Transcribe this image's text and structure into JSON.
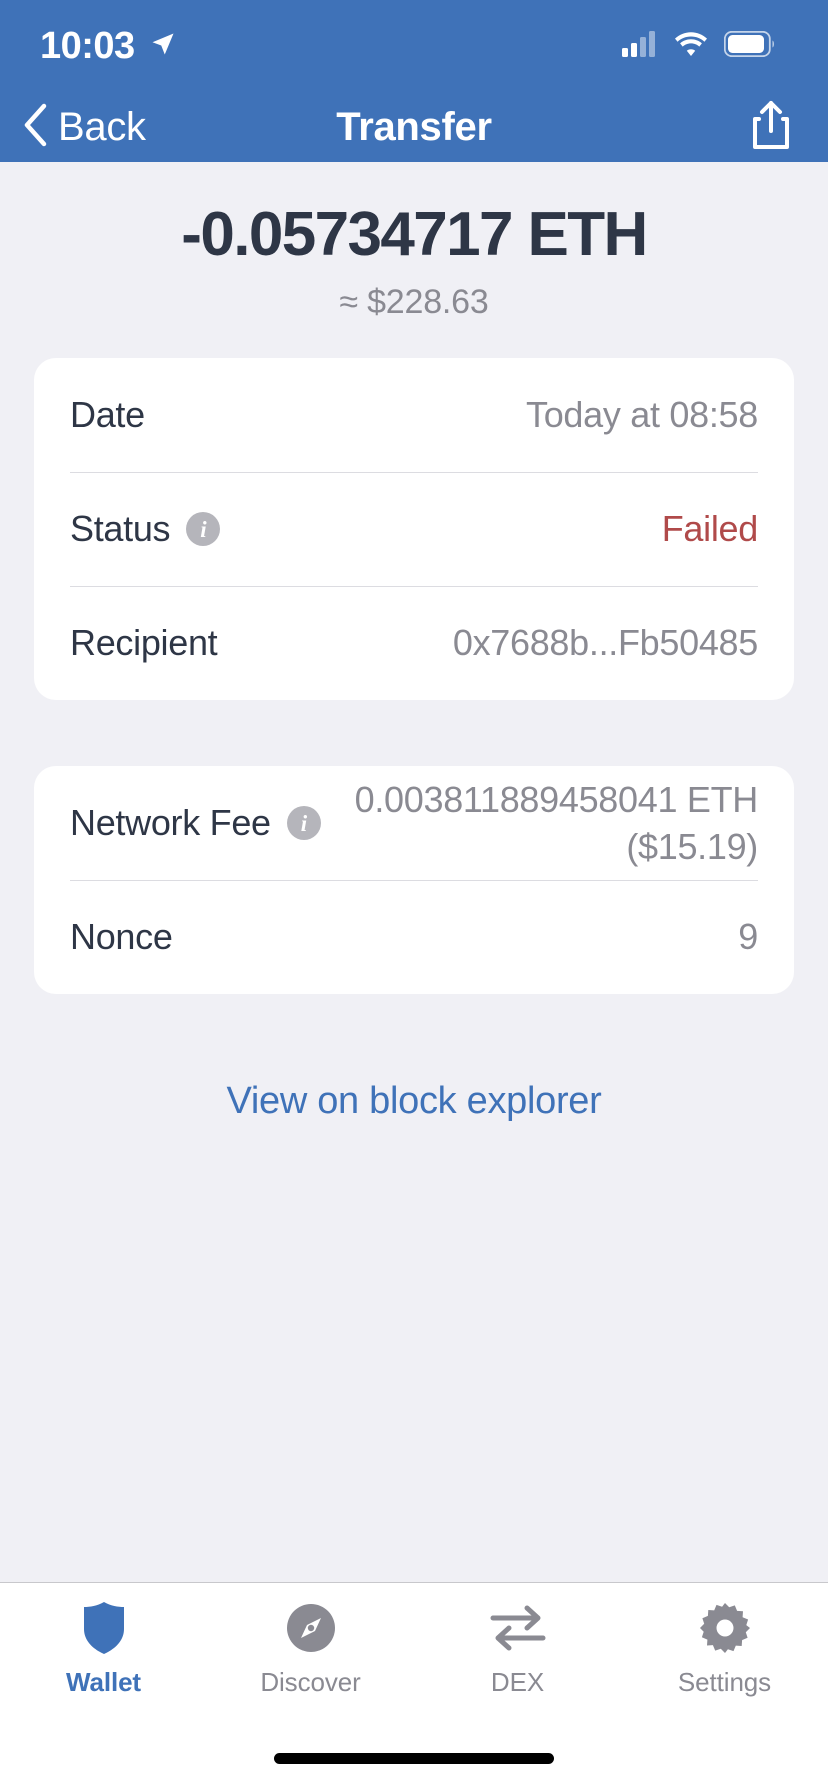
{
  "status_bar": {
    "time": "10:03",
    "location_icon": "location-arrow-icon",
    "cellular_icon": "cellular-signal-icon",
    "wifi_icon": "wifi-icon",
    "battery_icon": "battery-icon"
  },
  "nav": {
    "back_label": "Back",
    "title": "Transfer",
    "share_icon": "share-icon",
    "back_icon": "chevron-left-icon"
  },
  "amount": {
    "primary": "-0.05734717 ETH",
    "secondary": "≈ $228.63"
  },
  "details": {
    "date_label": "Date",
    "date_value": "Today at 08:58",
    "status_label": "Status",
    "status_value": "Failed",
    "recipient_label": "Recipient",
    "recipient_value": "0x7688b...Fb50485"
  },
  "fees": {
    "network_fee_label": "Network Fee",
    "network_fee_value": "0.003811889458041 ETH",
    "network_fee_fiat": "($15.19)",
    "nonce_label": "Nonce",
    "nonce_value": "9"
  },
  "explorer": {
    "link_label": "View on block explorer"
  },
  "tabs": [
    {
      "label": "Wallet",
      "icon": "shield-icon",
      "active": true
    },
    {
      "label": "Discover",
      "icon": "compass-icon",
      "active": false
    },
    {
      "label": "DEX",
      "icon": "swap-arrows-icon",
      "active": false
    },
    {
      "label": "Settings",
      "icon": "gear-icon",
      "active": false
    }
  ],
  "colors": {
    "header_blue": "#3f72b8",
    "accent_blue": "#3f72b8",
    "failed_red": "#b04a4a",
    "background": "#f0f0f5",
    "card_white": "#ffffff",
    "label_dark": "#2e3646",
    "value_gray": "#8a8a92"
  }
}
